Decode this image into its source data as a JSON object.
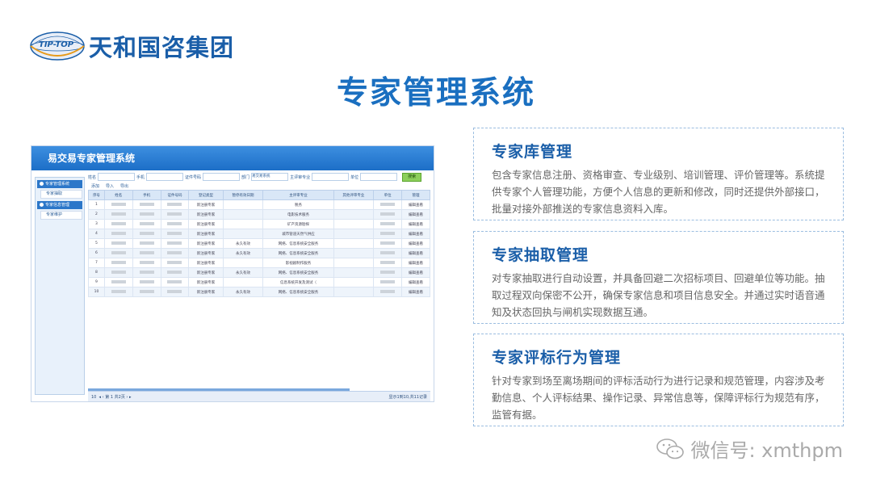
{
  "brand": {
    "logo_text": "TIP-TOP",
    "name": "天和国咨集团"
  },
  "page_title": "专家管理系统",
  "app": {
    "window_title": "易交易专家管理系统",
    "sidebar": [
      {
        "type": "header",
        "label": "专家管理系统"
      },
      {
        "type": "item",
        "label": "专家抽取"
      },
      {
        "type": "header",
        "label": "专家信息管理"
      },
      {
        "type": "item",
        "label": "专家维护"
      }
    ],
    "filters": {
      "name_label": "姓名",
      "phone_label": "手机",
      "id_label": "证件号码",
      "dept_label": "部门",
      "dept_value": "易交易系统",
      "major_label": "主评审专业",
      "unit_label": "单位",
      "search_label": "搜索"
    },
    "toolbar": {
      "add": "添加",
      "import": "导入",
      "export": "导出"
    },
    "columns": [
      "序号",
      "姓名",
      "手机",
      "证件号码",
      "登记类型",
      "暂停有效日期",
      "主评审专业",
      "其他评审专业",
      "单位",
      "管理"
    ],
    "rows": [
      {
        "no": "1",
        "type": "新注册专家",
        "date": "",
        "major": "税务",
        "action": "编辑查看"
      },
      {
        "no": "2",
        "type": "新注册专家",
        "date": "",
        "major": "电影技术服务",
        "action": "编辑查看"
      },
      {
        "no": "3",
        "type": "新注册专家",
        "date": "",
        "major": "矿产资源勘探",
        "action": "编辑查看"
      },
      {
        "no": "4",
        "type": "新注册专家",
        "date": "",
        "major": "城市管道天然气供应",
        "action": "编辑查看"
      },
      {
        "no": "5",
        "type": "新注册专家",
        "date": "永久有效",
        "major": "网络、信息系统安全服务",
        "action": "编辑查看"
      },
      {
        "no": "6",
        "type": "新注册专家",
        "date": "永久有效",
        "major": "网络、信息系统安全服务",
        "action": "编辑查看"
      },
      {
        "no": "7",
        "type": "新注册专家",
        "date": "",
        "major": "影视剧制作服务",
        "action": "编辑查看"
      },
      {
        "no": "8",
        "type": "新注册专家",
        "date": "永久有效",
        "major": "网络、信息系统安全服务",
        "action": "编辑查看"
      },
      {
        "no": "9",
        "type": "新注册专家",
        "date": "",
        "major": "信息系统开发及测试（",
        "action": "编辑查看"
      },
      {
        "no": "10",
        "type": "新注册专家",
        "date": "永久有效",
        "major": "网络、信息系统安全服务",
        "action": "编辑查看"
      }
    ],
    "pager": {
      "page_size": "10",
      "page_label": "第",
      "page_value": "1",
      "total_pages": "共2页",
      "summary": "显示1到10,共11记录"
    }
  },
  "features": [
    {
      "title": "专家库管理",
      "desc": "包含专家信息注册、资格审查、专业级别、培训管理、评价管理等。系统提供专家个人管理功能，方便个人信息的更新和修改，同时还提供外部接口，批量对接外部推送的专家信息资料入库。"
    },
    {
      "title": "专家抽取管理",
      "desc": "对专家抽取进行自动设置，并具备回避二次招标项目、回避单位等功能。抽取过程双向保密不公开，确保专家信息和项目信息安全。并通过实时语音通知及状态回执与闸机实现数据互通。"
    },
    {
      "title": "专家评标行为管理",
      "desc": "针对专家到场至离场期间的评标活动行为进行记录和规范管理，内容涉及考勤信息、个人评标结果、操作记录、异常信息等，保障评标行为规范有序，监管有据。"
    }
  ],
  "watermark": "微信号: xmthpm"
}
